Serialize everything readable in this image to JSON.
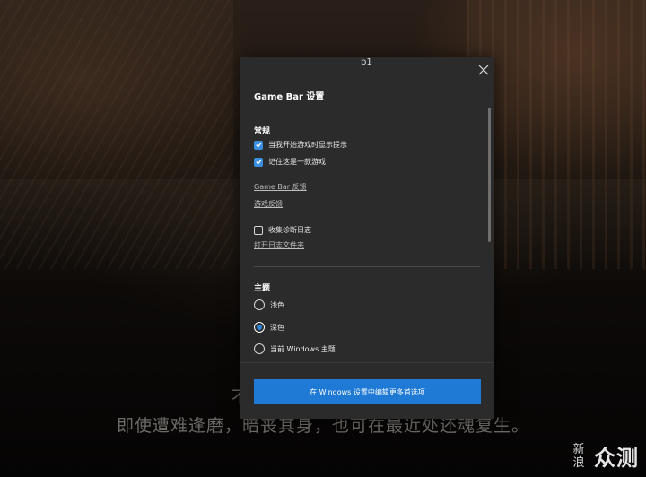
{
  "background": {
    "subtitle_line": "即使遭难逢磨，暗丧其身，也可在最近处还魂复生。",
    "subtitle_partial": "不"
  },
  "watermark": {
    "col1": [
      "新",
      "浪"
    ],
    "big": "众测"
  },
  "dialog": {
    "cursor_text": "b1",
    "title": "Game Bar 设置",
    "general": {
      "heading": "常规",
      "checkboxes": [
        {
          "label": "当我开始游戏时显示提示",
          "checked": true
        },
        {
          "label": "记住这是一款游戏",
          "checked": true
        }
      ],
      "links": [
        "Game Bar 反馈",
        "游戏反馈"
      ],
      "diagnostics": {
        "label": "收集诊断日志",
        "checked": false
      },
      "open_log_link": "打开日志文件夹"
    },
    "theme": {
      "heading": "主题",
      "options": [
        {
          "label": "浅色",
          "selected": false
        },
        {
          "label": "深色",
          "selected": true
        },
        {
          "label": "当前 Windows 主题",
          "selected": false
        }
      ]
    },
    "footer_button": "在 Windows 设置中编辑更多首选项"
  },
  "colors": {
    "accent": "#1f7ad6",
    "panel": "#2b2b2b",
    "checkbox": "#3a8fe0"
  },
  "icons": {
    "close": "close-icon",
    "check": "check-icon"
  }
}
